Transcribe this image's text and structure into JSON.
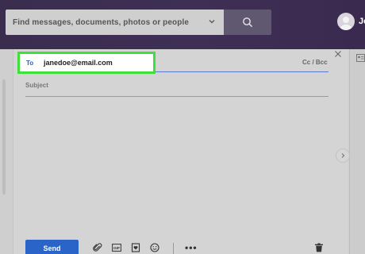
{
  "search": {
    "placeholder": "Find messages, documents, photos or people"
  },
  "user": {
    "name_partial": "Jo"
  },
  "compose": {
    "to_label": "To",
    "to_value": "janedoe@email.com",
    "cc_bcc_label": "Cc / Bcc",
    "subject_label": "Subject",
    "send_label": "Send",
    "more_label": "•••"
  },
  "colors": {
    "header_bg": "#3f2f55",
    "highlight": "#3fe03a",
    "send_button": "#2a64c8",
    "to_label": "#2d5fb4"
  },
  "icons": {
    "search": "search-icon",
    "chevron": "chevron-down-icon",
    "avatar": "avatar-icon",
    "close": "close-icon",
    "contacts": "contact-card-icon",
    "expand": "chevron-right-icon",
    "attach": "paperclip-icon",
    "gif": "gif-icon",
    "sticker": "sticker-icon",
    "emoji": "emoji-icon",
    "more": "more-options-icon",
    "delete": "trash-icon"
  }
}
